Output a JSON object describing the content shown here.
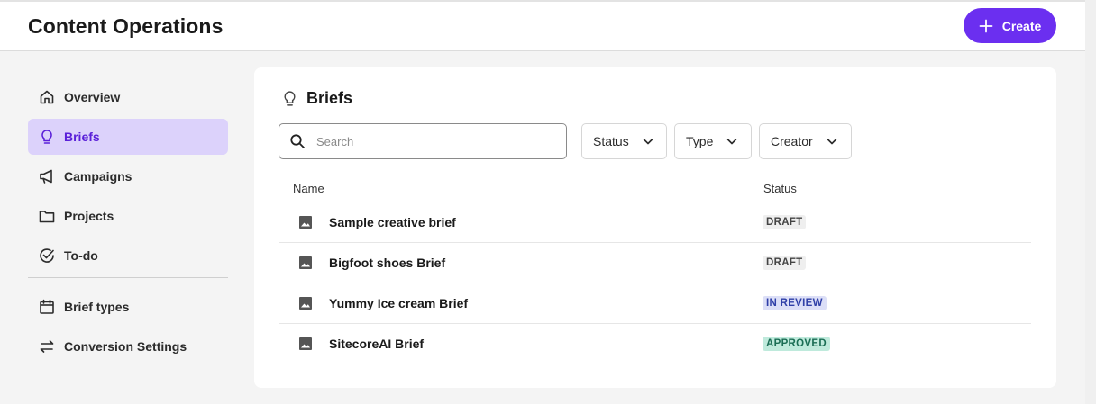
{
  "header": {
    "title": "Content Operations",
    "create_label": "Create"
  },
  "sidebar": {
    "items": [
      {
        "label": "Overview",
        "icon": "home-icon"
      },
      {
        "label": "Briefs",
        "icon": "lightbulb-icon",
        "active": true
      },
      {
        "label": "Campaigns",
        "icon": "megaphone-icon"
      },
      {
        "label": "Projects",
        "icon": "folder-icon"
      },
      {
        "label": "To-do",
        "icon": "check-circle-icon"
      }
    ],
    "secondary_items": [
      {
        "label": "Brief types",
        "icon": "calendar-icon"
      },
      {
        "label": "Conversion Settings",
        "icon": "swap-arrows-icon"
      }
    ]
  },
  "briefs": {
    "title": "Briefs",
    "search_placeholder": "Search",
    "filters": {
      "status": "Status",
      "type": "Type",
      "creator": "Creator"
    },
    "columns": {
      "name": "Name",
      "status": "Status"
    },
    "rows": [
      {
        "name": "Sample creative brief",
        "status": "DRAFT"
      },
      {
        "name": "Bigfoot shoes Brief",
        "status": "DRAFT"
      },
      {
        "name": "Yummy Ice cream Brief",
        "status": "IN REVIEW"
      },
      {
        "name": "SitecoreAI Brief",
        "status": "APPROVED"
      }
    ]
  },
  "colors": {
    "accent": "#6b2ff0",
    "active_nav_bg": "#dcd2fb",
    "active_nav_text": "#5a1fd9",
    "draft_badge_bg": "#efefef",
    "review_badge_bg": "#dcdff7",
    "approved_badge_bg": "#bfeadc"
  }
}
